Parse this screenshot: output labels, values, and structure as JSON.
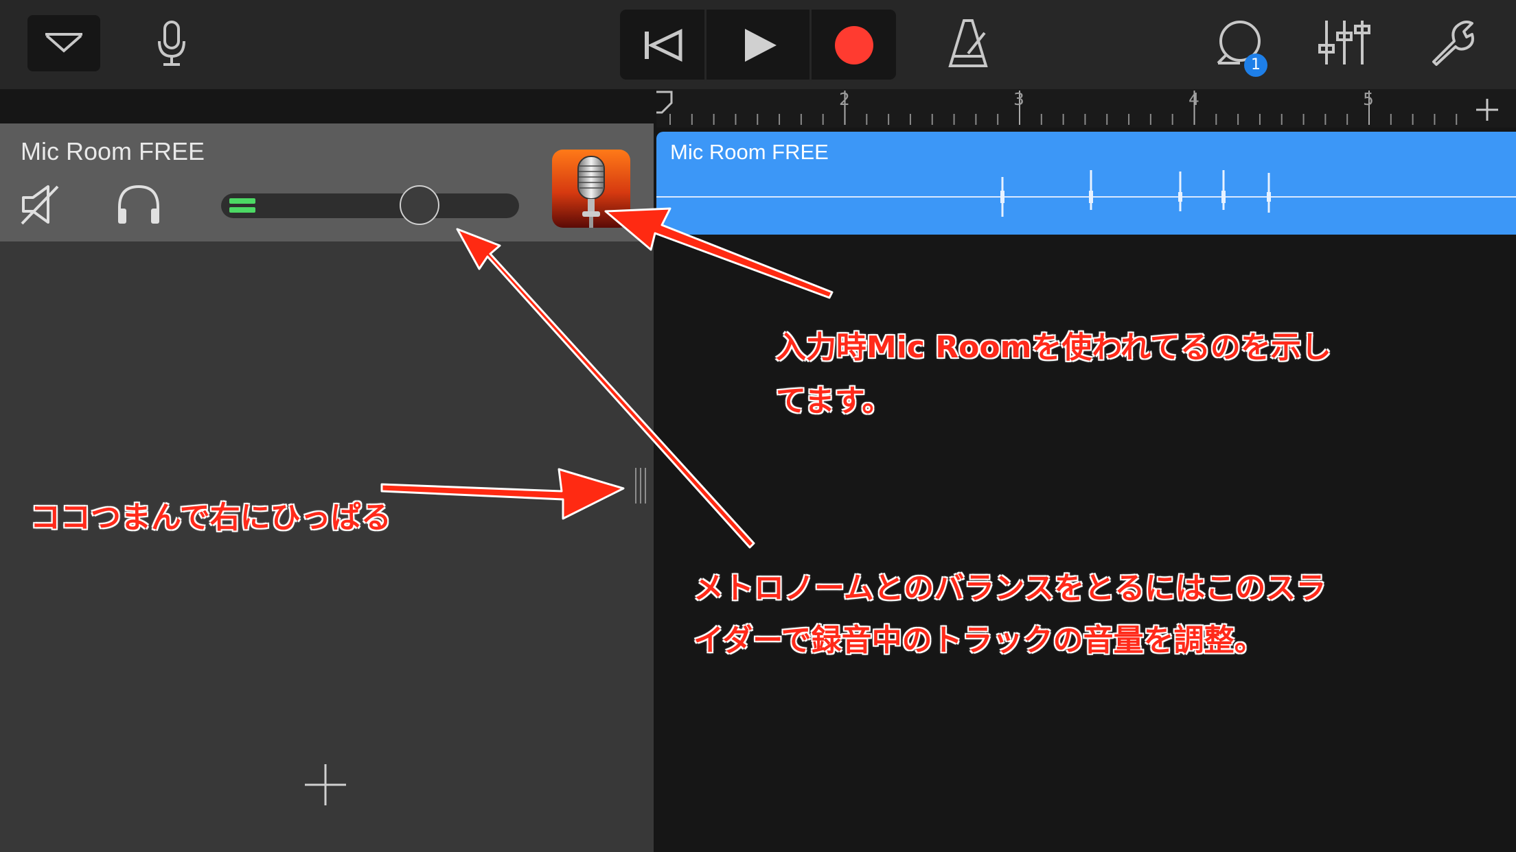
{
  "toolbar": {
    "tracks_view_icon": "chevron-down-icon",
    "input_icon": "microphone-icon",
    "transport": {
      "rewind_icon": "rewind-icon",
      "play_icon": "play-icon",
      "record_icon": "record-icon"
    },
    "metronome_icon": "metronome-icon",
    "loop_icon": "loop-icon",
    "loop_badge": "1",
    "mixer_icon": "mixer-icon",
    "settings_icon": "wrench-icon"
  },
  "ruler": {
    "bars": [
      "2",
      "3",
      "4",
      "5"
    ],
    "add_section_icon": "plus-icon"
  },
  "track": {
    "name": "Mic Room FREE",
    "mute_icon": "speaker-muted-icon",
    "solo_icon": "headphones-icon",
    "volume": 0.68,
    "instrument_icon": "vintage-microphone-icon"
  },
  "region": {
    "name": "Mic Room FREE"
  },
  "left_panel": {
    "add_track_icon": "plus-icon",
    "resize_handle_icon": "grip-icon"
  },
  "annotations": {
    "note1_line1": "入力時Mic Roomを使われてるのを示し",
    "note1_line2": "てます。",
    "note2": "ココつまんで右にひっぱる",
    "note3_line1": "メトロノームとのバランスをとるにはこのスラ",
    "note3_line2": "イダーで録音中のトラックの音量を調整。"
  },
  "colors": {
    "region_blue": "#3c97f7",
    "record_red": "#ff3b30",
    "annotation_red": "#ff2a1a",
    "level_green": "#4cd964"
  }
}
